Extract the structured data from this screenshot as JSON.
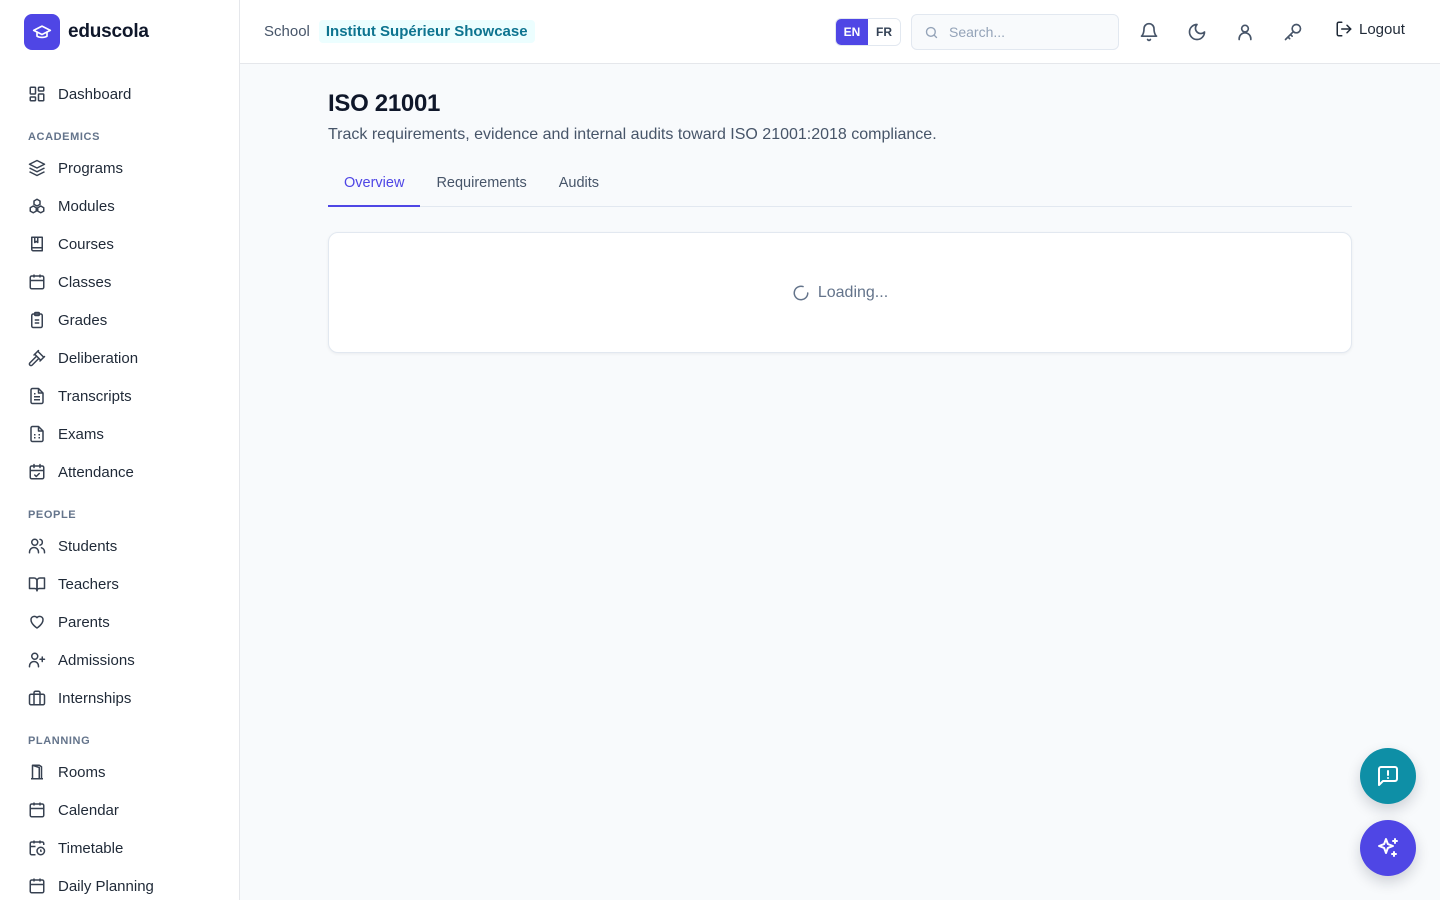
{
  "brand": {
    "name": "eduscola"
  },
  "sidebar": {
    "dashboard": "Dashboard",
    "sections": [
      {
        "title": "ACADEMICS",
        "items": [
          "Programs",
          "Modules",
          "Courses",
          "Classes",
          "Grades",
          "Deliberation",
          "Transcripts",
          "Exams",
          "Attendance"
        ]
      },
      {
        "title": "PEOPLE",
        "items": [
          "Students",
          "Teachers",
          "Parents",
          "Admissions",
          "Internships"
        ]
      },
      {
        "title": "PLANNING",
        "items": [
          "Rooms",
          "Calendar",
          "Timetable",
          "Daily Planning"
        ]
      }
    ]
  },
  "header": {
    "school_label": "School",
    "school_name": "Institut Supérieur Showcase",
    "lang_en": "EN",
    "lang_fr": "FR",
    "search_placeholder": "Search...",
    "logout": "Logout"
  },
  "page": {
    "title": "ISO 21001",
    "subtitle": "Track requirements, evidence and internal audits toward ISO 21001:2018 compliance.",
    "tabs": [
      "Overview",
      "Requirements",
      "Audits"
    ],
    "active_tab": "Overview",
    "loading": "Loading..."
  },
  "colors": {
    "primary": "#4f46e5",
    "teal": "#0e8fa6",
    "badge_bg": "#ecfeff",
    "badge_fg": "#0e7490"
  }
}
